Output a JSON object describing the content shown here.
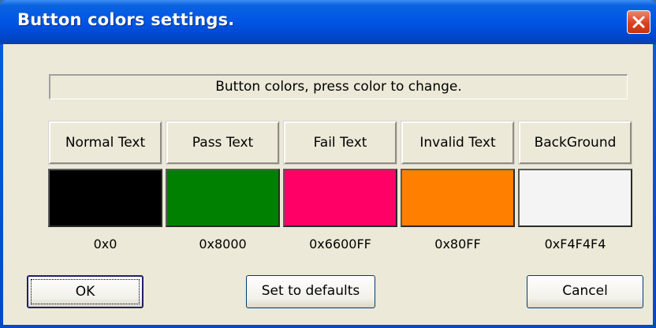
{
  "window": {
    "title": "Button colors settings."
  },
  "banner_text": "Button colors, press color to change.",
  "color_items": [
    {
      "label": "Normal Text",
      "hex": "0x0",
      "color": "#000000"
    },
    {
      "label": "Pass Text",
      "hex": "0x8000",
      "color": "#008000"
    },
    {
      "label": "Fail Text",
      "hex": "0x6600FF",
      "color": "#ff0066"
    },
    {
      "label": "Invalid Text",
      "hex": "0x80FF",
      "color": "#ff8000"
    },
    {
      "label": "BackGround",
      "hex": "0xF4F4F4",
      "color": "#f4f4f4"
    }
  ],
  "buttons": {
    "ok_label": "OK",
    "defaults_label": "Set to defaults",
    "cancel_label": "Cancel"
  }
}
